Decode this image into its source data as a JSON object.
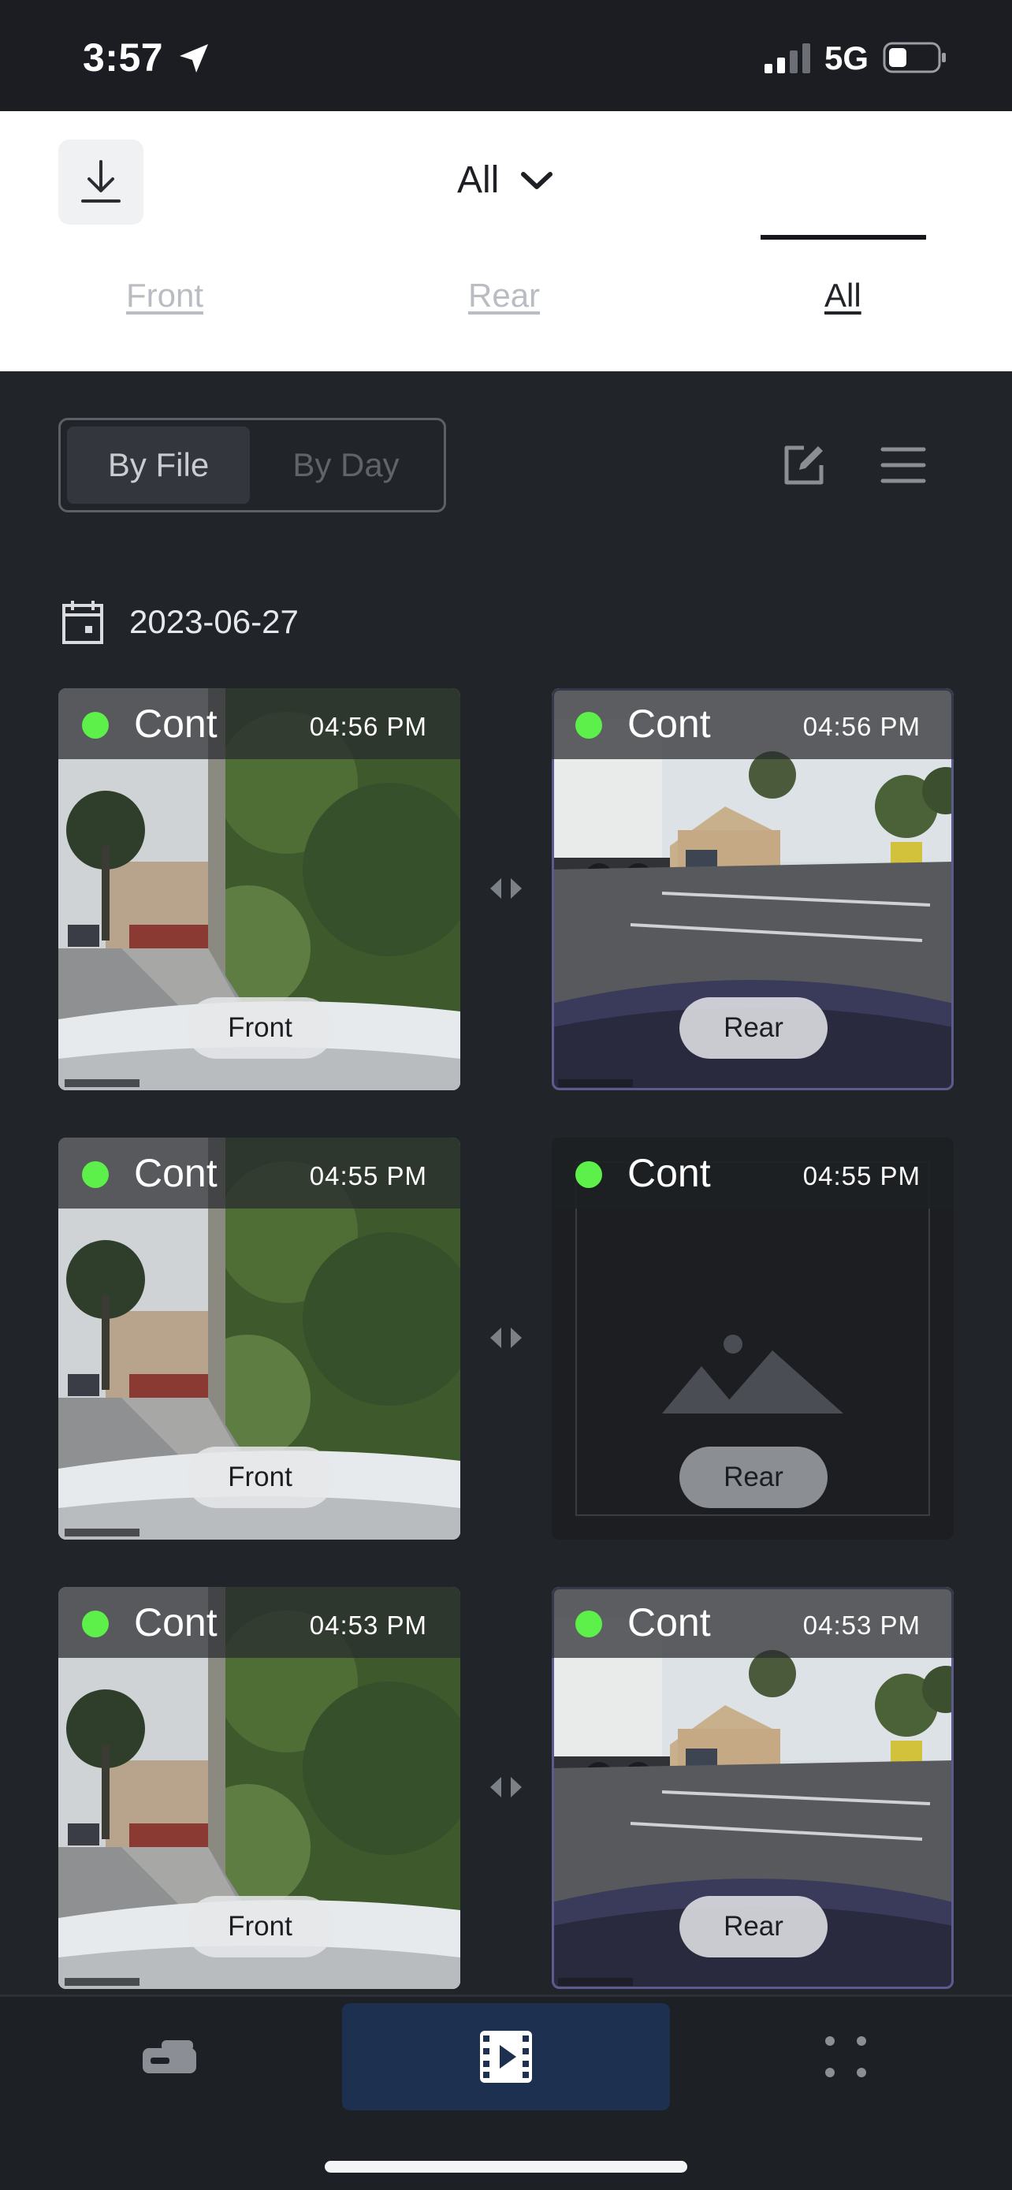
{
  "status_bar": {
    "time": "3:57",
    "network": "5G",
    "icons": [
      "location-arrow-icon",
      "signal-icon",
      "battery-icon"
    ]
  },
  "header": {
    "download_icon": "download-icon",
    "filter_label": "All",
    "tabs": [
      {
        "label": "Front",
        "active": false
      },
      {
        "label": "Rear",
        "active": false
      },
      {
        "label": "All",
        "active": true
      }
    ]
  },
  "controls": {
    "by_file": "By File",
    "by_day": "By Day",
    "selected": "By File",
    "edit_icon": "edit-icon",
    "menu_icon": "menu-icon"
  },
  "date": "2023-06-27",
  "clips": [
    {
      "front": {
        "type": "Cont",
        "time": "04:56 PM",
        "label": "Front"
      },
      "rear": {
        "type": "Cont",
        "time": "04:56 PM",
        "label": "Rear",
        "has_thumbnail": true
      }
    },
    {
      "front": {
        "type": "Cont",
        "time": "04:55 PM",
        "label": "Front"
      },
      "rear": {
        "type": "Cont",
        "time": "04:55 PM",
        "label": "Rear",
        "has_thumbnail": false
      }
    },
    {
      "front": {
        "type": "Cont",
        "time": "04:53 PM",
        "label": "Front"
      },
      "rear": {
        "type": "Cont",
        "time": "04:53 PM",
        "label": "Rear",
        "has_thumbnail": true
      }
    }
  ],
  "bottom_nav": [
    {
      "icon": "dashcam-icon",
      "active": false
    },
    {
      "icon": "film-play-icon",
      "active": true
    },
    {
      "icon": "more-grid-icon",
      "active": false
    }
  ],
  "colors": {
    "accent_green": "#5ef04a",
    "nav_active": "#1d3050",
    "background": "#212429"
  }
}
